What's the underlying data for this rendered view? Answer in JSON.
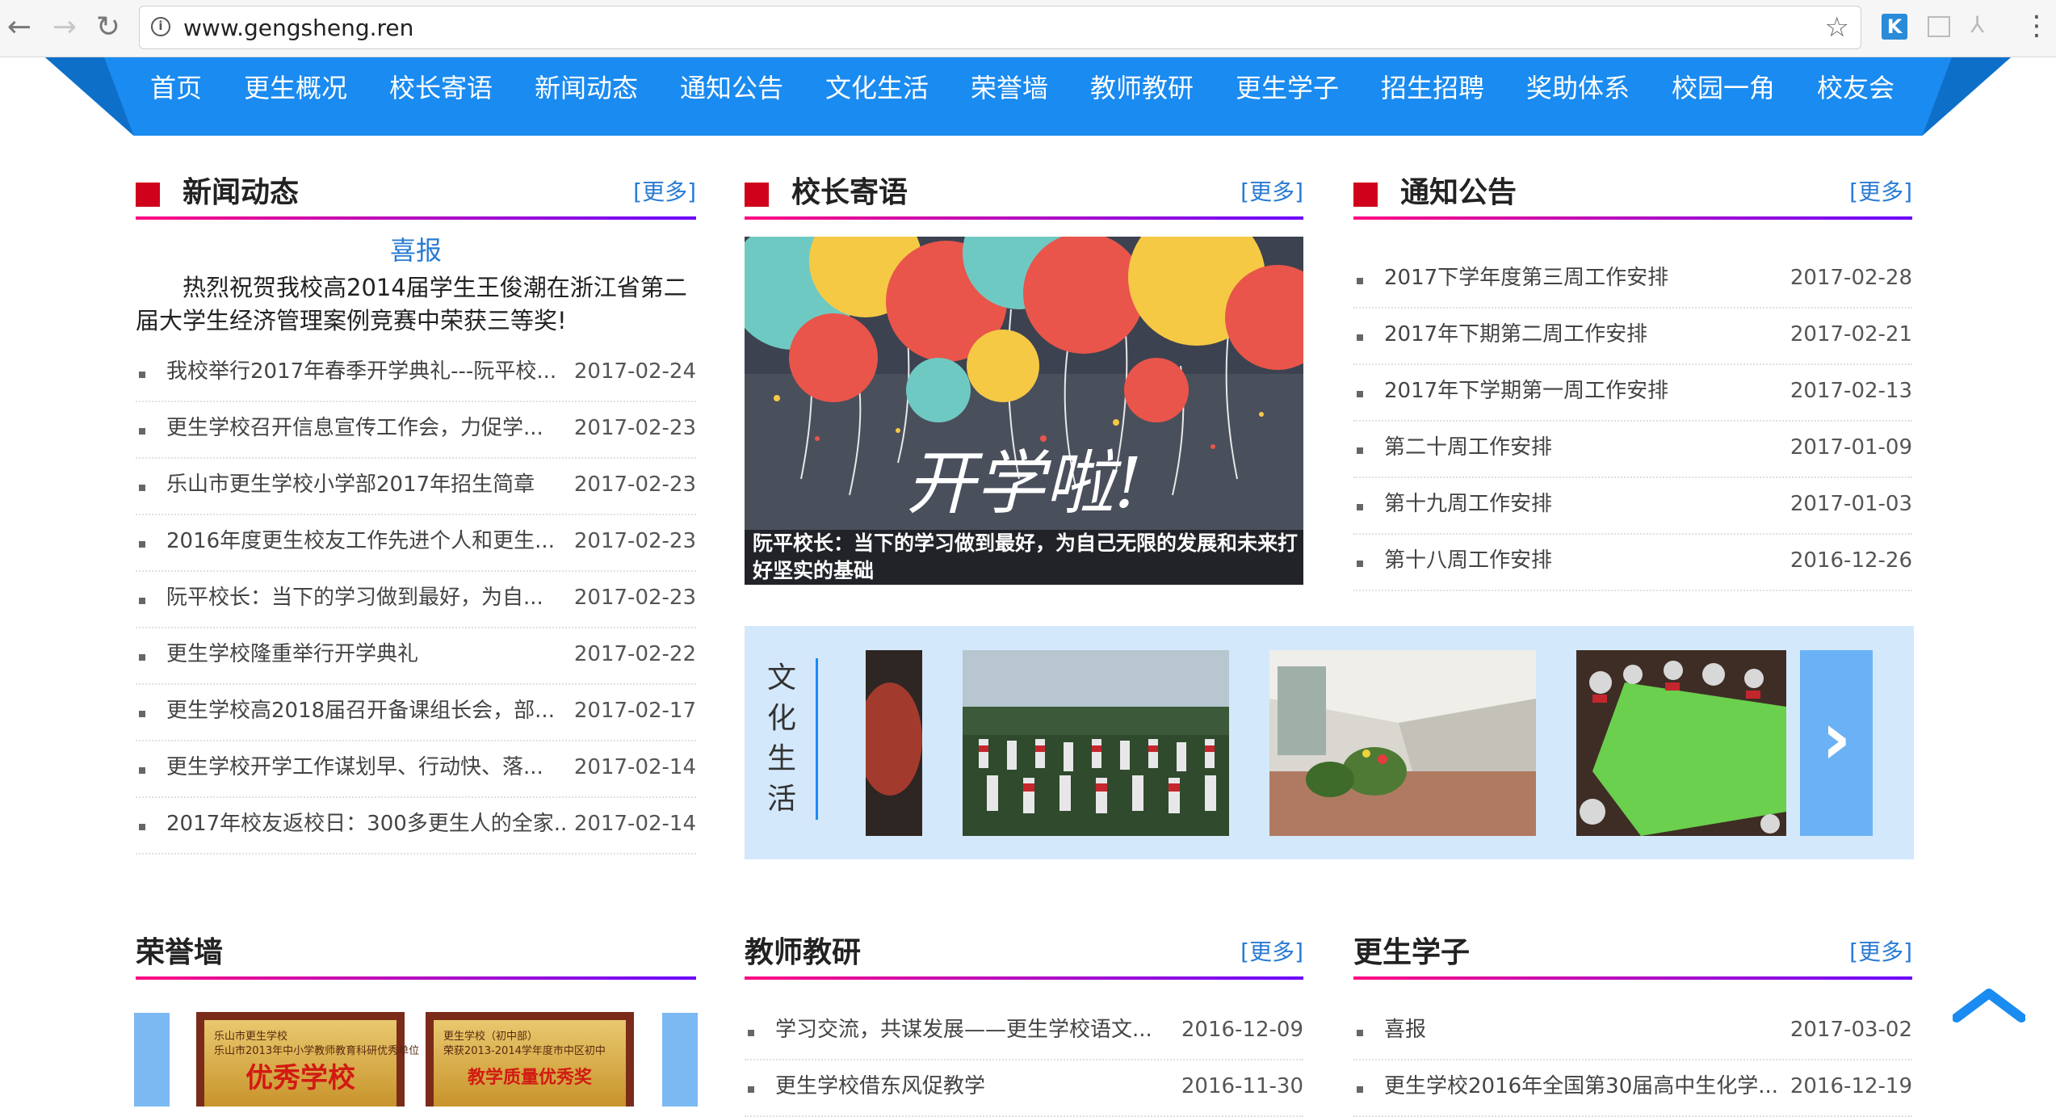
{
  "browser": {
    "url": "www.gengsheng.ren",
    "ext_k": "K"
  },
  "nav": {
    "items": [
      "首页",
      "更生概况",
      "校长寄语",
      "新闻动态",
      "通知公告",
      "文化生活",
      "荣誉墙",
      "教师教研",
      "更生学子",
      "招生招聘",
      "奖助体系",
      "校园一角",
      "校友会"
    ]
  },
  "news": {
    "title": "新闻动态",
    "more": "[更多]",
    "highlight_title": "喜报",
    "highlight_body": "热烈祝贺我校高2014届学生王俊潮在浙江省第二届大学生经济管理案例竞赛中荣获三等奖!",
    "items": [
      {
        "title": "我校举行2017年春季开学典礼---阮平校...",
        "date": "2017-02-24"
      },
      {
        "title": "更生学校召开信息宣传工作会，力促学...",
        "date": "2017-02-23"
      },
      {
        "title": "乐山市更生学校小学部2017年招生简章",
        "date": "2017-02-23"
      },
      {
        "title": "2016年度更生校友工作先进个人和更生...",
        "date": "2017-02-23"
      },
      {
        "title": "阮平校长：当下的学习做到最好，为自...",
        "date": "2017-02-23"
      },
      {
        "title": "更生学校隆重举行开学典礼",
        "date": "2017-02-22"
      },
      {
        "title": "更生学校高2018届召开备课组长会，部...",
        "date": "2017-02-17"
      },
      {
        "title": "更生学校开学工作谋划早、行动快、落...",
        "date": "2017-02-14"
      },
      {
        "title": "2017年校友返校日：300多更生人的全家..",
        "date": "2017-02-14"
      }
    ]
  },
  "principal": {
    "title": "校长寄语",
    "more": "[更多]",
    "image_text": "开学啦!",
    "caption": "阮平校长：当下的学习做到最好，为自己无限的发展和未来打好坚实的基础"
  },
  "notice": {
    "title": "通知公告",
    "more": "[更多]",
    "items": [
      {
        "title": "2017下学年度第三周工作安排",
        "date": "2017-02-28"
      },
      {
        "title": "2017年下期第二周工作安排",
        "date": "2017-02-21"
      },
      {
        "title": "2017年下学期第一周工作安排",
        "date": "2017-02-13"
      },
      {
        "title": "第二十周工作安排",
        "date": "2017-01-09"
      },
      {
        "title": "第十九周工作安排",
        "date": "2017-01-03"
      },
      {
        "title": "第十八周工作安排",
        "date": "2016-12-26"
      }
    ]
  },
  "culture": {
    "title": "文化生活",
    "chars": [
      "文",
      "化",
      "生",
      "活"
    ],
    "next": "›"
  },
  "honor": {
    "title": "荣誉墙",
    "plaque1_small": "乐山市更生学校\n乐山市2013年中小学教师教育科研优秀单位",
    "plaque1_big": "优秀学校",
    "plaque2_small": "更生学校（初中部）\n荣获2013-2014学年度市中区初中",
    "plaque2_big": "教学质量优秀奖"
  },
  "research": {
    "title": "教师教研",
    "more": "[更多]",
    "items": [
      {
        "title": "学习交流，共谋发展——更生学校语文...",
        "date": "2016-12-09"
      },
      {
        "title": "更生学校借东风促教学",
        "date": "2016-11-30"
      }
    ]
  },
  "students": {
    "title": "更生学子",
    "more": "[更多]",
    "items": [
      {
        "title": "喜报",
        "date": "2017-03-02"
      },
      {
        "title": "更生学校2016年全国第30届高中生化学...",
        "date": "2016-12-19"
      }
    ]
  }
}
